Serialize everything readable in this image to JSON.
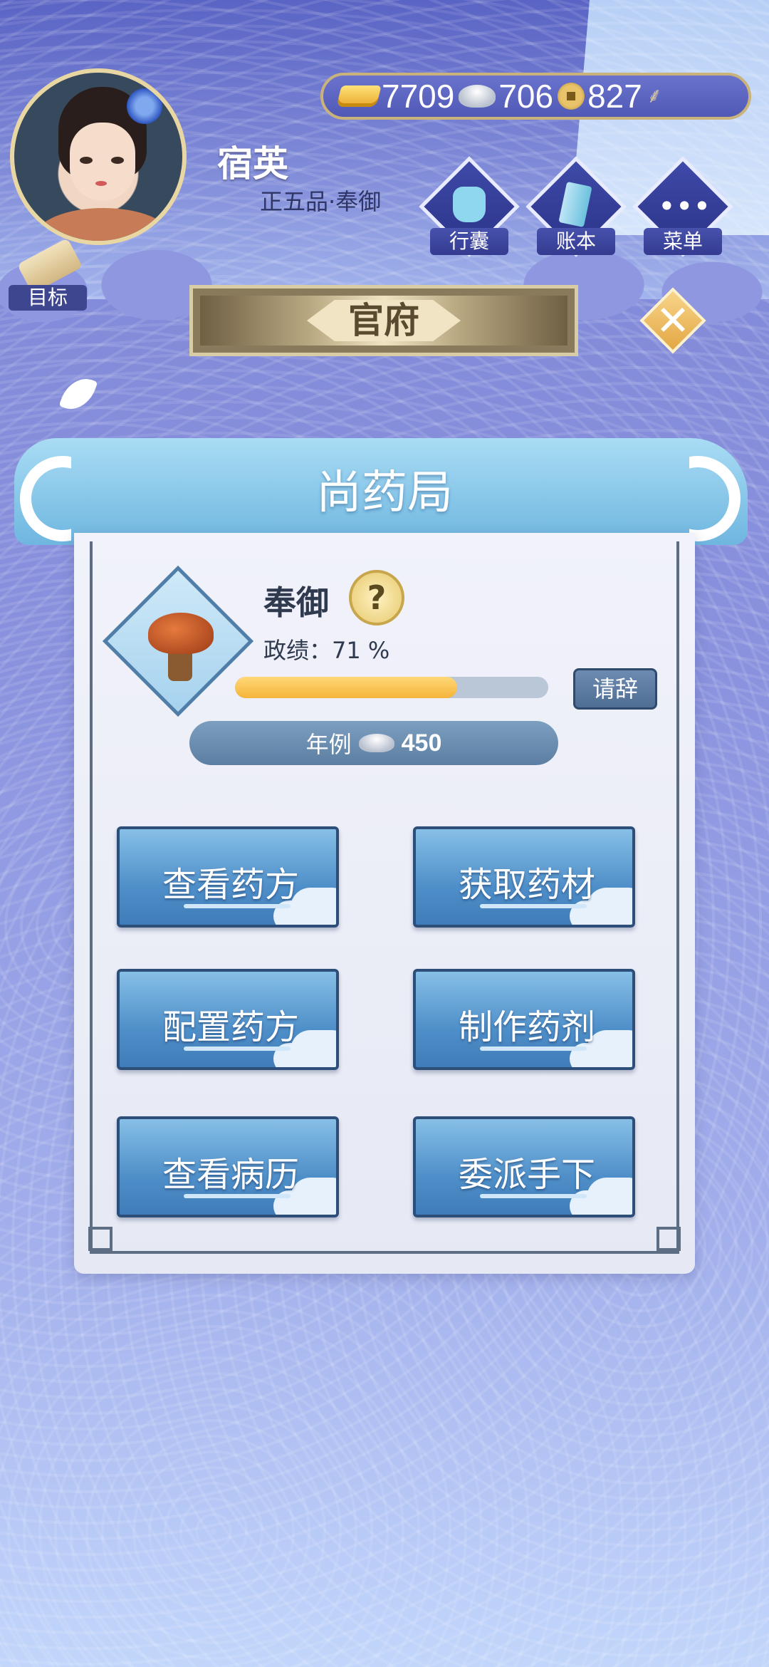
{
  "currency": {
    "gold": "7709",
    "silver": "706",
    "coin": "827"
  },
  "player": {
    "name": "宿英",
    "rank": "正五品·奉御"
  },
  "top_buttons": [
    {
      "label": "行囊",
      "icon": "bag-icon"
    },
    {
      "label": "账本",
      "icon": "ledger-icon"
    },
    {
      "label": "菜单",
      "icon": "menu-icon"
    }
  ],
  "goal": {
    "label": "目标"
  },
  "banner": {
    "title": "官府"
  },
  "office": {
    "title": "尚药局",
    "post_name": "奉御",
    "help_symbol": "?",
    "merit_label": "政绩：71 %",
    "merit_percent": 71,
    "resign_label": "请辞",
    "salary_label": "年例",
    "salary_value": "450"
  },
  "actions": [
    {
      "label": "查看药方"
    },
    {
      "label": "获取药材"
    },
    {
      "label": "配置药方"
    },
    {
      "label": "制作药剂"
    },
    {
      "label": "查看病历"
    },
    {
      "label": "委派手下"
    }
  ],
  "colors": {
    "panel_border": "#5c6d84",
    "progress_fill": "#f5b43a",
    "button_blue": "#4f8fc9"
  }
}
